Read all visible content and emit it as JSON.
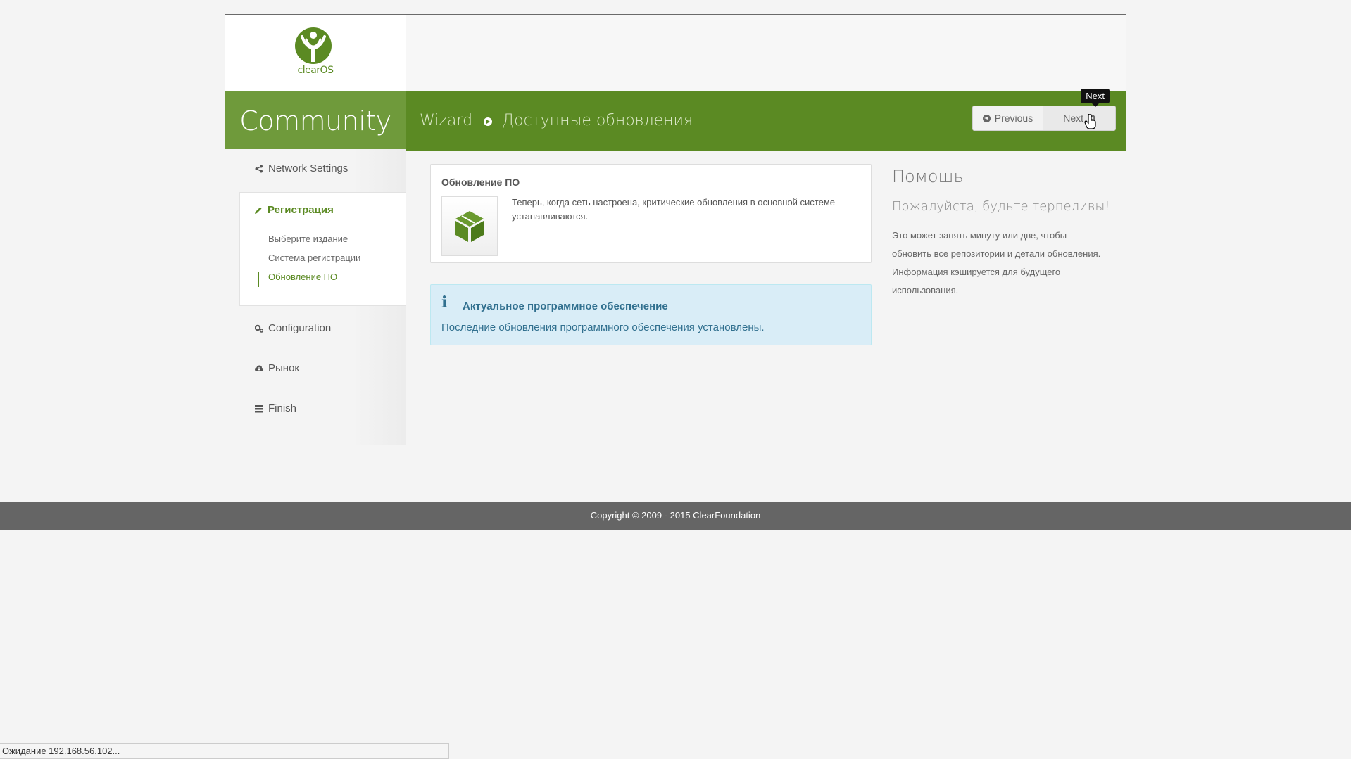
{
  "logo": {
    "text": "clearOS"
  },
  "header": {
    "edition": "Community",
    "breadcrumb": [
      "Wizard",
      "Доступные обновления"
    ],
    "prev_label": "Previous",
    "next_label": "Next",
    "tooltip": "Next"
  },
  "sidebar": {
    "items": [
      {
        "label": "Network Settings",
        "icon": "share-icon"
      },
      {
        "label": "Регистрация",
        "icon": "pencil-icon",
        "active": true
      },
      {
        "label": "Configuration",
        "icon": "gears-icon"
      },
      {
        "label": "Рынок",
        "icon": "cloud-download-icon"
      },
      {
        "label": "Finish",
        "icon": "tasks-icon"
      }
    ],
    "sub_items": [
      "Выберите издание",
      "Система регистрации",
      "Обновление ПО"
    ],
    "active_sub": 2
  },
  "card": {
    "title": "Обновление ПО",
    "text": "Теперь, когда сеть настроена, критические обновления в основной системе устанавливаются.",
    "icon": "package-box-icon"
  },
  "alert": {
    "title": "Актуальное программное обеспечение",
    "text": "Последние обновления программного обеспечения установлены."
  },
  "help": {
    "title": "Помошь",
    "subtitle": "Пожалуйста, будьте терпеливы!",
    "text": "Это может занять минуту или две, чтобы обновить все репозитории и детали обновления. Информация кэшируется для будущего использования."
  },
  "footer": {
    "copyright": "Copyright © 2009 - 2015 ClearFoundation"
  },
  "statusbar": {
    "text": "Ожидание 192.168.56.102..."
  },
  "colors": {
    "brand_green": "#5b8a23",
    "edition_green": "#6f9a3b",
    "alert_bg": "#d9edf7",
    "footer_bg": "#656565"
  }
}
